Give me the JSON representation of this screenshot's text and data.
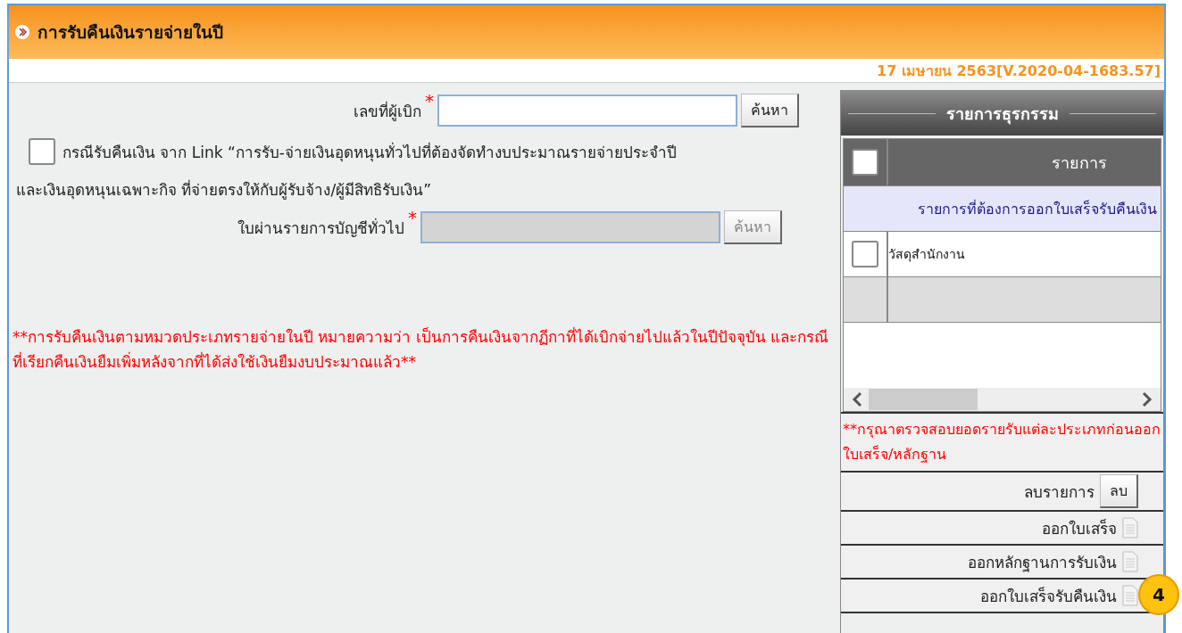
{
  "header": {
    "title": "การรับคืนเงินรายจ่ายในปี"
  },
  "version_line": "17 เมษายน 2563[V.2020-04-1683.57]",
  "form": {
    "payer_field": {
      "label": "เลขที่ผู้เบิก",
      "required_mark": "*",
      "button": "ค้นหา",
      "disabled": false
    },
    "link_option": {
      "checked": false,
      "label": "กรณีรับคืนเงิน จาก Link “การรับ-จ่ายเงินอุดหนุนทั่วไปที่ต้องจัดทำงบประมาณรายจ่ายประจำปี",
      "continuation": "และเงินอุดหนุนเฉพาะกิจ ที่จ่ายตรงให้กับผู้รับจ้าง/ผู้มีสิทธิรับเงิน”"
    },
    "voucher_field": {
      "label": "ใบผ่านรายการบัญชีทั่วไป",
      "required_mark": "*",
      "button": "ค้นหา",
      "disabled": true
    },
    "note": "**การรับคืนเงินตามหมวดประเภทรายจ่ายในปี หมายความว่า เป็นการคืนเงินจากฏีกาที่ได้เบิกจ่ายไปแล้วในปีปัจจุบัน และกรณีที่เรียกคืนเงินยืมเพิ่มหลังจากที่ได้ส่งใช้เงินยืมงบประมาณแล้ว**"
  },
  "panel": {
    "title": "รายการธุรกรรม",
    "table": {
      "header_checked": false,
      "column": "รายการ",
      "group_row": "รายการที่ต้องการออกใบเสร็จรับคืนเงิน",
      "rows": [
        {
          "label": "วัสดุสำนักงาน",
          "checked": false
        }
      ]
    },
    "note": "**กรุณาตรวจสอบยอดรายรับแต่ละประเภทก่อนออกใบเสร็จ/หลักฐาน",
    "delete_row": {
      "label": "ลบรายการ",
      "button": "ลบ"
    },
    "actions": [
      {
        "label": "ออกใบเสร็จ"
      },
      {
        "label": "ออกหลักฐานการรับเงิน"
      },
      {
        "label": "ออกใบเสร็จรับคืนเงิน"
      }
    ],
    "badge": "4"
  }
}
